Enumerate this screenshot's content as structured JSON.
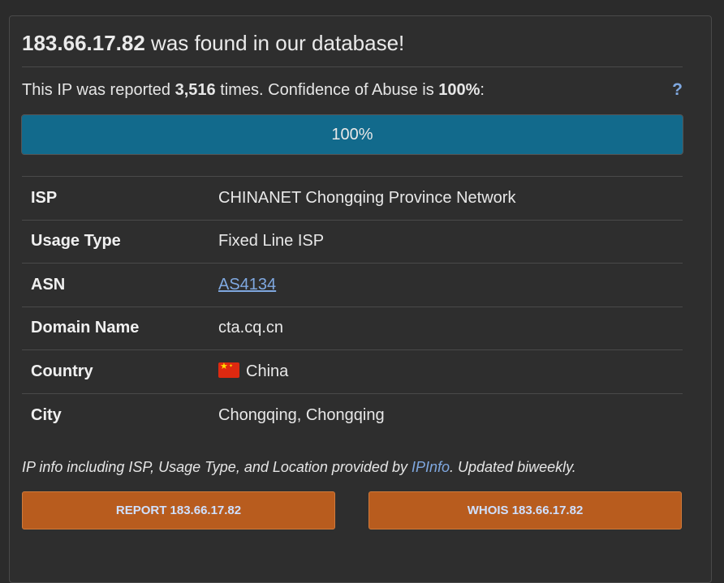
{
  "title": {
    "ip": "183.66.17.82",
    "suffix": " was found in our database!"
  },
  "reported": {
    "prefix": "This IP was reported ",
    "count": "3,516",
    "middle": " times. Confidence of Abuse is ",
    "confidence": "100%",
    "suffix": ":",
    "help": "?"
  },
  "progress": {
    "label": "100%",
    "value": 100,
    "fill_color": "#126a8c"
  },
  "info_rows": [
    {
      "label": "ISP",
      "value": "CHINANET Chongqing Province Network"
    },
    {
      "label": "Usage Type",
      "value": "Fixed Line ISP"
    },
    {
      "label": "ASN",
      "value": "AS4134"
    },
    {
      "label": "Domain Name",
      "value": "cta.cq.cn"
    },
    {
      "label": "Country",
      "value": "China",
      "icon": "china-flag-icon"
    },
    {
      "label": "City",
      "value": "Chongqing, Chongqing"
    }
  ],
  "footnote": {
    "prefix": "IP info including ISP, Usage Type, and Location provided by ",
    "link": "IPInfo",
    "suffix": ". Updated biweekly."
  },
  "buttons": {
    "report": "REPORT 183.66.17.82",
    "whois": "WHOIS 183.66.17.82"
  },
  "colors": {
    "accent_link": "#7fa8e0",
    "button_bg": "#b85c1e",
    "background": "#2b2b2b"
  }
}
